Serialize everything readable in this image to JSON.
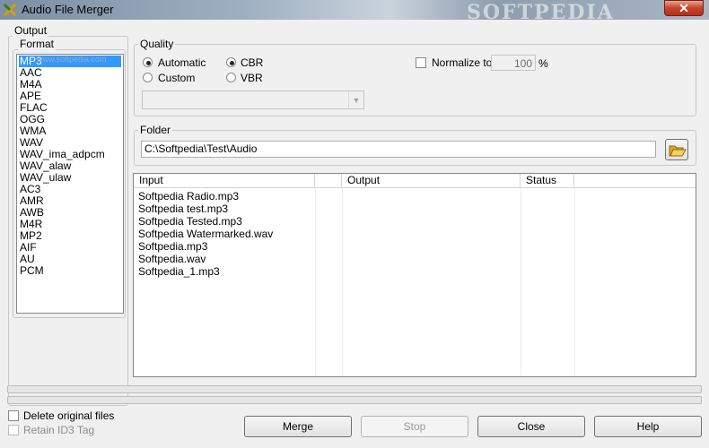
{
  "window": {
    "title": "Audio File Merger",
    "close_glyph": "✕",
    "watermark": "SOFTPEDIA"
  },
  "output": {
    "group_label": "Output",
    "format_label": "Format",
    "formats": [
      "MP3",
      "AAC",
      "M4A",
      "APE",
      "FLAC",
      "OGG",
      "WMA",
      "WAV",
      "WAV_ima_adpcm",
      "WAV_alaw",
      "WAV_ulaw",
      "AC3",
      "AMR",
      "AWB",
      "M4R",
      "MP2",
      "AIF",
      "AU",
      "PCM"
    ],
    "selected_format": "MP3",
    "list_watermark": "www.softpedia.com"
  },
  "quality": {
    "label": "Quality",
    "automatic": "Automatic",
    "custom": "Custom",
    "cbr": "CBR",
    "vbr": "VBR",
    "selected_mode": "Automatic",
    "selected_bitrate_mode": "CBR",
    "bitrate_value": "",
    "normalize_label": "Normalize to",
    "normalize_checked": false,
    "normalize_value": "100",
    "normalize_unit": "%"
  },
  "folder": {
    "label": "Folder",
    "path": "C:\\Softpedia\\Test\\Audio",
    "browse_icon": "folder-open-icon"
  },
  "files_table": {
    "columns": [
      "Input",
      "",
      "Output",
      "Status",
      ""
    ],
    "rows": [
      {
        "input": "Softpedia Radio.mp3"
      },
      {
        "input": "Softpedia test.mp3"
      },
      {
        "input": "Softpedia Tested.mp3"
      },
      {
        "input": "Softpedia Watermarked.wav"
      },
      {
        "input": "Softpedia.mp3"
      },
      {
        "input": "Softpedia.wav"
      },
      {
        "input": "Softpedia_1.mp3"
      }
    ]
  },
  "options": {
    "delete_original": "Delete original files",
    "retain_id3": "Retain ID3 Tag"
  },
  "buttons": {
    "merge": "Merge",
    "stop": "Stop",
    "close": "Close",
    "help": "Help"
  }
}
